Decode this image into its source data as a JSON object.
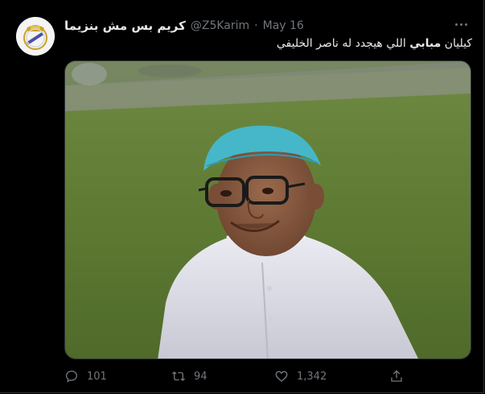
{
  "tweet": {
    "display_name": "كريم بس مش بنزيما",
    "handle": "@Z5Karim",
    "separator": "·",
    "date": "May 16",
    "text_part1": "كيليان ",
    "text_bold": "مبابي",
    "text_part2": " اللي هيجدد له ناصر الخليفي"
  },
  "actions": {
    "reply_count": "101",
    "retweet_count": "94",
    "like_count": "1,342"
  },
  "icons": {
    "reply": "reply-icon",
    "retweet": "retweet-icon",
    "like": "heart-icon",
    "share": "share-icon",
    "more": "more-options-icon",
    "avatar": "real-madrid-crest-icon"
  },
  "colors": {
    "background": "#000000",
    "text_primary": "#e7e9ea",
    "text_secondary": "#71767b"
  }
}
